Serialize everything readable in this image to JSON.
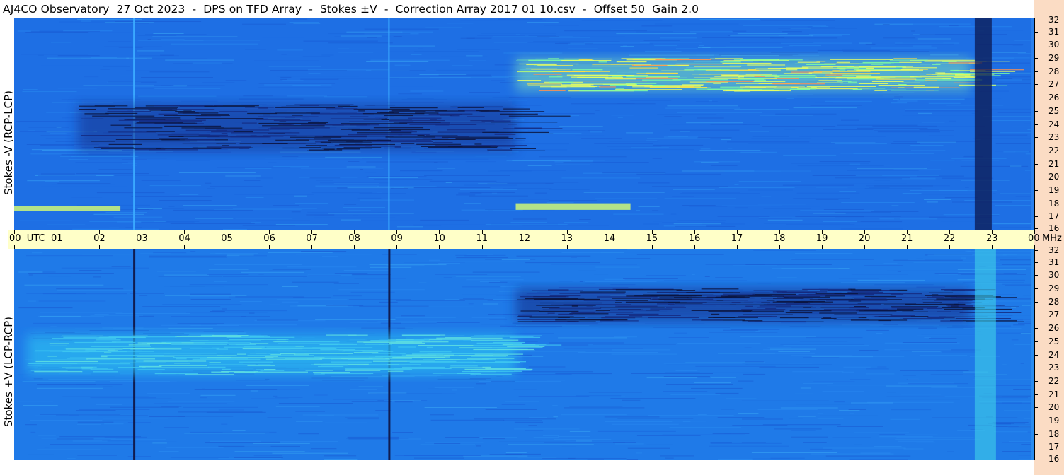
{
  "title": "AJ4CO Observatory  27 Oct 2023  -  DPS on TFD Array  -  Stokes ±V  -  Correction Array 2017 01 10.csv  -  Offset 50  Gain 2.0",
  "colors": {
    "background": "#ffffff",
    "axis_band": "#ffffc8",
    "right_strip": "#fbdcc4",
    "spectrogram_base": "#1f73e6",
    "spectrogram_dark": "#12308c",
    "spectrogram_light": "#2ab8f0",
    "spectrogram_hot": "#e8ff60"
  },
  "chart_data": [
    {
      "type": "heatmap",
      "panel": "top",
      "ylabel": "Stokes -V (RCP-LCP)",
      "x_tick_labels": [
        "00  UTC",
        "01",
        "02",
        "03",
        "04",
        "05",
        "06",
        "07",
        "08",
        "09",
        "10",
        "11",
        "12",
        "13",
        "14",
        "15",
        "16",
        "17",
        "18",
        "19",
        "20",
        "21",
        "22",
        "23",
        "00"
      ],
      "x_range": [
        0,
        24
      ],
      "x_unit": "UTC",
      "y_tick_labels": [
        "32",
        "31",
        "30",
        "29",
        "28",
        "27",
        "26",
        "25",
        "24",
        "23",
        "22",
        "21",
        "20",
        "19",
        "18",
        "17",
        "16"
      ],
      "y_range": [
        16,
        32
      ],
      "y_unit": "MHz",
      "colormap": "jet",
      "features": [
        {
          "kind": "vertical_line",
          "x": 2.8,
          "color": "#3aa8ff"
        },
        {
          "kind": "vertical_line",
          "x": 8.8,
          "color": "#3aa8ff"
        },
        {
          "kind": "dark_region",
          "x": [
            1.5,
            11.8
          ],
          "y": [
            22,
            25.5
          ]
        },
        {
          "kind": "bright_region",
          "x": [
            11.8,
            22.5
          ],
          "y": [
            26.5,
            29
          ]
        },
        {
          "kind": "bright_band",
          "x": [
            0,
            2.5
          ],
          "y": [
            17.4,
            17.8
          ]
        },
        {
          "kind": "bright_band",
          "x": [
            11.8,
            14.5
          ],
          "y": [
            17.5,
            18
          ]
        },
        {
          "kind": "dark_column",
          "x": [
            22.6,
            23.0
          ]
        }
      ]
    },
    {
      "type": "heatmap",
      "panel": "bottom",
      "ylabel": "Stokes +V (LCP-RCP)",
      "x_range": [
        0,
        24
      ],
      "x_unit": "UTC",
      "y_tick_labels": [
        "32",
        "31",
        "30",
        "29",
        "28",
        "27",
        "26",
        "25",
        "24",
        "23",
        "22",
        "21",
        "20",
        "19",
        "18",
        "17",
        "16"
      ],
      "y_range": [
        16,
        32
      ],
      "y_unit": "MHz",
      "colormap": "jet",
      "features": [
        {
          "kind": "vertical_line",
          "x": 2.8,
          "color": "#101c50"
        },
        {
          "kind": "vertical_line",
          "x": 8.8,
          "color": "#101c50"
        },
        {
          "kind": "light_region",
          "x": [
            0.3,
            11.8
          ],
          "y": [
            22.5,
            25.5
          ]
        },
        {
          "kind": "dark_region",
          "x": [
            11.8,
            22.5
          ],
          "y": [
            26.5,
            29
          ]
        },
        {
          "kind": "light_column",
          "x": [
            22.6,
            23.1
          ]
        }
      ]
    }
  ],
  "mhz_label": "MHz"
}
